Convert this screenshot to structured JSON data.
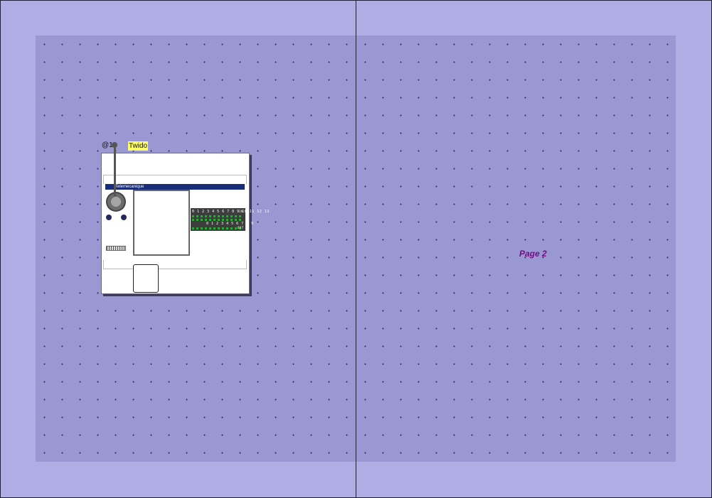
{
  "canvas": {
    "pages": [
      {
        "label": ""
      },
      {
        "label": "Page 2"
      }
    ]
  },
  "device": {
    "address": "@1",
    "name": "Twido",
    "brand": "Telemecanique",
    "io_inputs_label": "0 1 2 3 4 5 6 7 8 9 10 11 12 13",
    "io_outputs_label": "0 1 2 3 4 5 6 7 8 9",
    "io_in_tag": "IN",
    "io_out_tag": "OUT"
  },
  "colors": {
    "background": "#aeaee4",
    "page": "#9a98d2",
    "page_label": "#7a0a86",
    "name_tag": "#ffff66",
    "brand_bar": "#1a2d7a"
  }
}
